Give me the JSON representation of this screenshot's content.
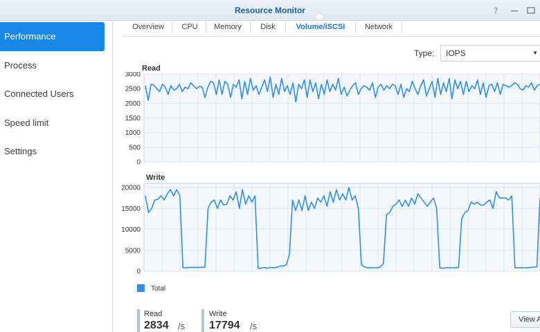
{
  "window": {
    "title": "Resource Monitor",
    "help_icon": "help-icon",
    "minimize_icon": "minimize-icon",
    "maximize_icon": "maximize-icon"
  },
  "sidebar": {
    "items": [
      {
        "label": "Performance",
        "active": true
      },
      {
        "label": "Process",
        "active": false
      },
      {
        "label": "Connected Users",
        "active": false
      },
      {
        "label": "Speed limit",
        "active": false
      },
      {
        "label": "Settings",
        "active": false
      }
    ]
  },
  "tabs": [
    {
      "label": "Overview",
      "active": false
    },
    {
      "label": "CPU",
      "active": false
    },
    {
      "label": "Memory",
      "active": false
    },
    {
      "label": "Disk",
      "active": false
    },
    {
      "label": "Volume/iSCSI",
      "active": true
    },
    {
      "label": "Network",
      "active": false
    }
  ],
  "type_filter": {
    "label": "Type:",
    "value": "IOPS"
  },
  "colors": {
    "accent": "#1888e8",
    "series": "#2f8ee6",
    "plot_bg": "#f4f8fd",
    "grid": "#dde6ef"
  },
  "legend": {
    "label": "Total"
  },
  "stats": {
    "read": {
      "label": "Read",
      "value": "2834",
      "unit": "/s"
    },
    "write": {
      "label": "Write",
      "value": "17794",
      "unit": "/s"
    }
  },
  "view_button": {
    "label": "View A"
  },
  "chart_data": [
    {
      "type": "line",
      "title": "Read",
      "ylim": [
        0,
        3000
      ],
      "yticks": [
        "3000",
        "2500",
        "2000",
        "1500",
        "1000",
        "500",
        "0"
      ],
      "grid": true,
      "series": [
        {
          "values": [
            2600,
            2100,
            2650,
            2620,
            2500,
            2400,
            2650,
            2550,
            2300,
            2600,
            2450,
            2500,
            2650,
            2400,
            2550,
            2500,
            2700,
            2600,
            2500,
            2580,
            2550,
            2200,
            2550,
            2750,
            2700,
            2300,
            2800,
            2300,
            2750,
            2650,
            2200,
            2650,
            2550,
            2800,
            2150,
            2750,
            2300,
            2850,
            2450,
            2600,
            2300,
            2550,
            2800,
            2400,
            2900,
            2200,
            2650,
            2300,
            2850,
            2400,
            2600,
            2300,
            2700,
            2050,
            2650,
            2500,
            2800,
            2200,
            2800,
            2400,
            2700,
            2150,
            2650,
            2300,
            2800,
            2400,
            2650,
            2450,
            2850,
            2300,
            2550,
            2250,
            2450,
            2600,
            2700,
            2300,
            2500,
            2600,
            2550,
            2450,
            2700,
            2200,
            2550,
            2650,
            2450,
            2600,
            2500,
            2650,
            2600,
            2300,
            2650,
            2200,
            2500,
            2400,
            2750,
            2500,
            2300,
            2600,
            2800,
            2250,
            2500,
            2750,
            2200,
            2850,
            2300,
            2700,
            2400,
            2850,
            2150,
            2800,
            2500,
            2750,
            2300,
            2750,
            2400,
            2600,
            2500,
            2800,
            2300,
            2700,
            2200,
            2600,
            2650,
            2400,
            2700,
            2300,
            2650,
            2600,
            2550,
            2600,
            2700,
            2650,
            2500,
            2450,
            2600,
            2550,
            2700,
            2450,
            2600,
            2650
          ]
        }
      ]
    },
    {
      "type": "line",
      "title": "Write",
      "ylim": [
        0,
        21000
      ],
      "yticks": [
        "20000",
        "15000",
        "10000",
        "5000",
        "0"
      ],
      "grid": true,
      "series": [
        {
          "name": "Total",
          "values": [
            18000,
            14000,
            15000,
            17000,
            17200,
            18000,
            17000,
            18500,
            19500,
            18000,
            19500,
            18000,
            800,
            800,
            900,
            900,
            900,
            900,
            900,
            1000,
            15000,
            16500,
            17000,
            15000,
            17000,
            15800,
            16000,
            18000,
            17000,
            19000,
            15000,
            19500,
            16000,
            18000,
            16500,
            18000,
            700,
            700,
            900,
            700,
            900,
            800,
            900,
            1200,
            1200,
            1500,
            4000,
            17000,
            14500,
            17000,
            14500,
            18000,
            14500,
            16500,
            15000,
            17500,
            16500,
            18000,
            15500,
            19000,
            16500,
            19500,
            17000,
            18500,
            17000,
            20000,
            17000,
            18000,
            15000,
            1500,
            1000,
            800,
            800,
            800,
            800,
            1000,
            1800,
            13500,
            14000,
            15500,
            16000,
            17000,
            15500,
            17000,
            15500,
            17500,
            16000,
            18500,
            17500,
            16500,
            15500,
            16500,
            17500,
            15000,
            800,
            700,
            800,
            800,
            800,
            800,
            900,
            12500,
            14000,
            14500,
            16500,
            16000,
            16500,
            15800,
            15800,
            16500,
            17000,
            15000,
            19000,
            17500,
            17500,
            17500,
            17000,
            18000,
            800,
            800,
            800,
            800,
            800,
            900,
            1000,
            1000,
            17500
          ]
        }
      ]
    }
  ]
}
